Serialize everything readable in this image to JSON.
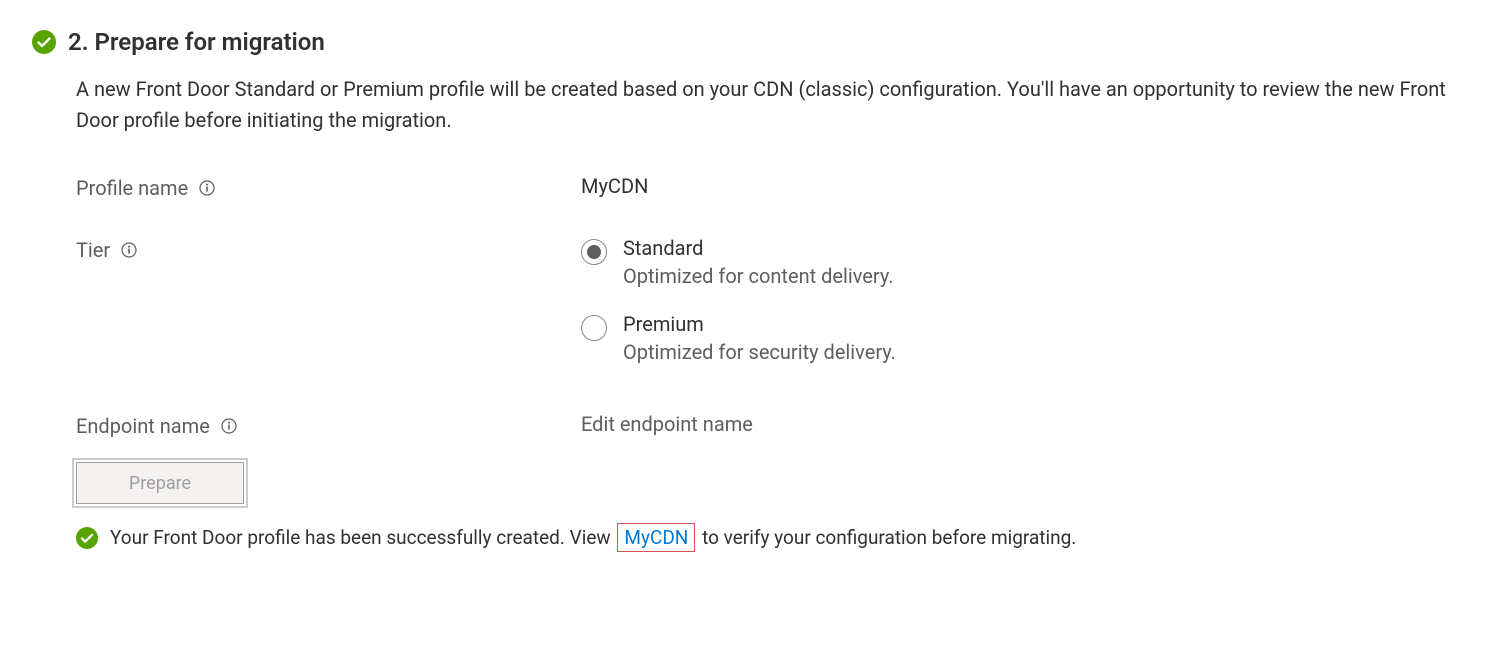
{
  "step": {
    "title": "2. Prepare for migration",
    "description": "A new Front Door Standard or Premium profile will be created based on your CDN (classic) configuration. You'll have an opportunity to review the new Front Door profile before initiating the migration."
  },
  "form": {
    "profile_name_label": "Profile name",
    "profile_name_value": "MyCDN",
    "tier_label": "Tier",
    "tier_options": {
      "standard": {
        "label": "Standard",
        "sub": "Optimized for content delivery."
      },
      "premium": {
        "label": "Premium",
        "sub": "Optimized for security delivery."
      }
    },
    "endpoint_label": "Endpoint name",
    "endpoint_value": "Edit endpoint name"
  },
  "buttons": {
    "prepare": "Prepare"
  },
  "status": {
    "prefix": "Your Front Door profile has been successfully created. View ",
    "link": "MyCDN",
    "suffix": " to verify your configuration before migrating."
  }
}
